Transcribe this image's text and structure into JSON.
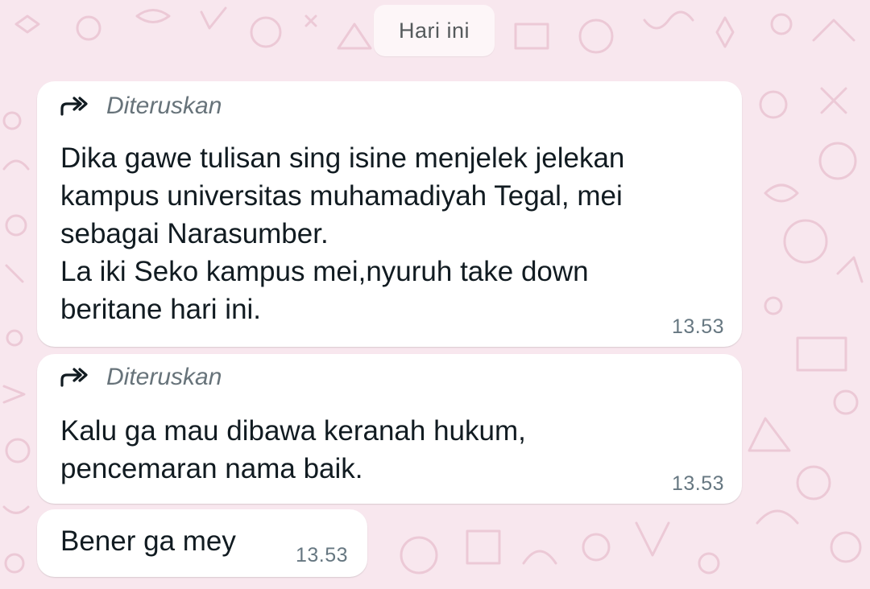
{
  "date_divider": "Hari ini",
  "messages": [
    {
      "forwarded_label": "Diteruskan",
      "text": "Dika gawe tulisan sing isine menjelek jelekan\nkampus universitas muhamadiyah Tegal, mei\nsebagai Narasumber.\nLa iki Seko kampus mei,nyuruh take down\nberitane hari ini.",
      "time": "13.53"
    },
    {
      "forwarded_label": "Diteruskan",
      "text": "Kalu ga mau dibawa keranah hukum,\npencemaran nama baik.",
      "time": "13.53"
    },
    {
      "text": "Bener ga mey",
      "time": "13.53"
    }
  ],
  "icons": {
    "forward": "forward-arrow-icon"
  },
  "colors": {
    "wallpaper": "#f8e7ee",
    "bubble": "#ffffff",
    "text": "#111b21",
    "meta": "#667781"
  }
}
